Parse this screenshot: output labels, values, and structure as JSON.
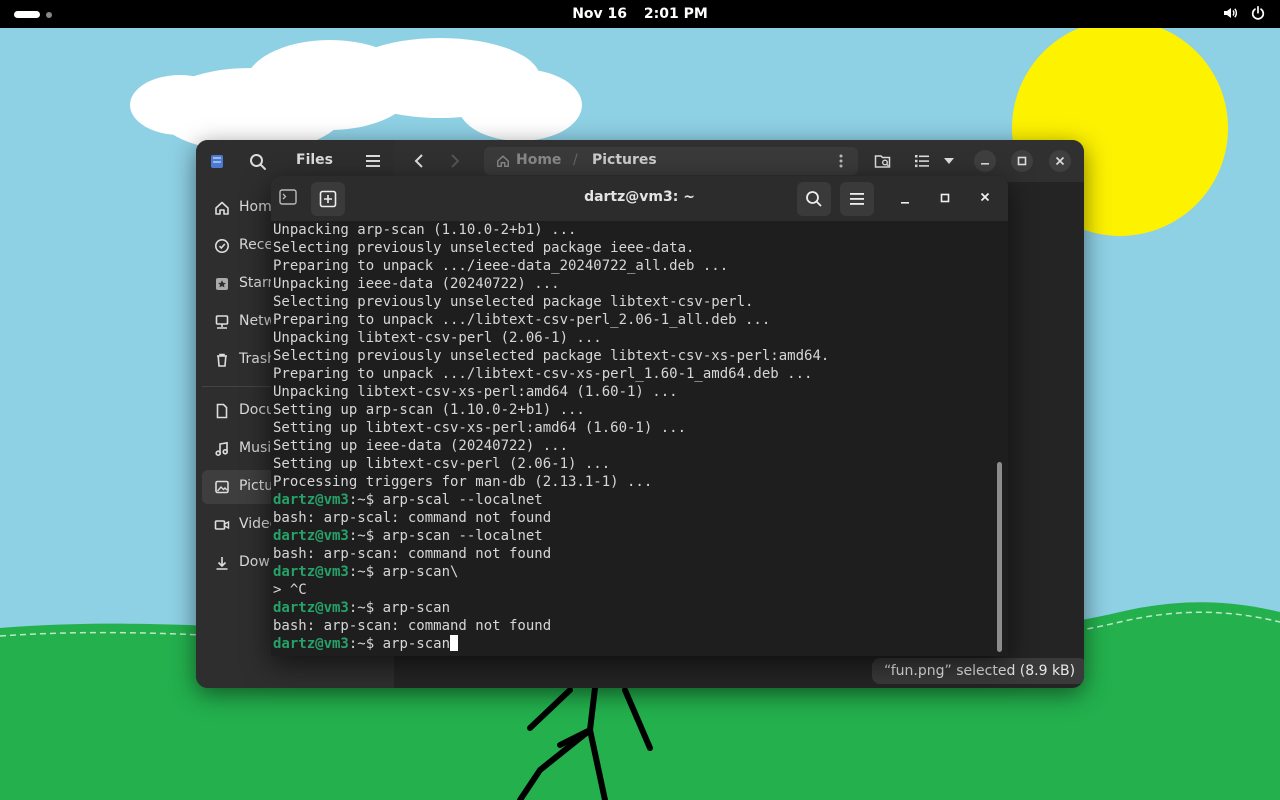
{
  "topbar": {
    "date": "Nov 16",
    "time": "2:01 PM"
  },
  "files": {
    "title": "Files",
    "path": [
      "Home",
      "Pictures"
    ],
    "sidebar": [
      {
        "label": "Home",
        "icon": "home-icon"
      },
      {
        "label": "Recent",
        "icon": "clock-icon"
      },
      {
        "label": "Starred",
        "icon": "star-icon"
      },
      {
        "label": "Network",
        "icon": "network-icon"
      },
      {
        "label": "Trash",
        "icon": "trash-icon"
      },
      {
        "label": "Documents",
        "icon": "document-icon"
      },
      {
        "label": "Music",
        "icon": "music-icon"
      },
      {
        "label": "Pictures",
        "icon": "picture-icon"
      },
      {
        "label": "Videos",
        "icon": "video-icon"
      },
      {
        "label": "Downloads",
        "icon": "download-icon"
      }
    ],
    "status": "“fun.png” selected  (8.9 kB)"
  },
  "terminal": {
    "title": "dartz@vm3: ~",
    "prompt_user": "dartz@vm3",
    "prompt_path": ":~$",
    "lines": [
      {
        "text": "Unpacking arp-scan (1.10.0-2+b1) ..."
      },
      {
        "text": "Selecting previously unselected package ieee-data."
      },
      {
        "text": "Preparing to unpack .../ieee-data_20240722_all.deb ..."
      },
      {
        "text": "Unpacking ieee-data (20240722) ..."
      },
      {
        "text": "Selecting previously unselected package libtext-csv-perl."
      },
      {
        "text": "Preparing to unpack .../libtext-csv-perl_2.06-1_all.deb ..."
      },
      {
        "text": "Unpacking libtext-csv-perl (2.06-1) ..."
      },
      {
        "text": "Selecting previously unselected package libtext-csv-xs-perl:amd64."
      },
      {
        "text": "Preparing to unpack .../libtext-csv-xs-perl_1.60-1_amd64.deb ..."
      },
      {
        "text": "Unpacking libtext-csv-xs-perl:amd64 (1.60-1) ..."
      },
      {
        "text": "Setting up arp-scan (1.10.0-2+b1) ..."
      },
      {
        "text": "Setting up libtext-csv-xs-perl:amd64 (1.60-1) ..."
      },
      {
        "text": "Setting up ieee-data (20240722) ..."
      },
      {
        "text": "Setting up libtext-csv-perl (2.06-1) ..."
      },
      {
        "text": "Processing triggers for man-db (2.13.1-1) ..."
      },
      {
        "prompt": true,
        "text": " arp-scal --localnet"
      },
      {
        "text": "bash: arp-scal: command not found"
      },
      {
        "prompt": true,
        "text": " arp-scan --localnet"
      },
      {
        "text": "bash: arp-scan: command not found"
      },
      {
        "prompt": true,
        "text": " arp-scan\\"
      },
      {
        "text": "> ^C"
      },
      {
        "prompt": true,
        "text": " arp-scan"
      },
      {
        "text": "bash: arp-scan: command not found"
      },
      {
        "prompt": true,
        "text": " arp-scan",
        "cursor": true
      }
    ]
  },
  "colors": {
    "sky": "#8ed0e4",
    "grass": "#23b04d",
    "sun": "#fdf200",
    "prompt_green": "#26a269",
    "terminal_bg": "#1e1e1e"
  }
}
